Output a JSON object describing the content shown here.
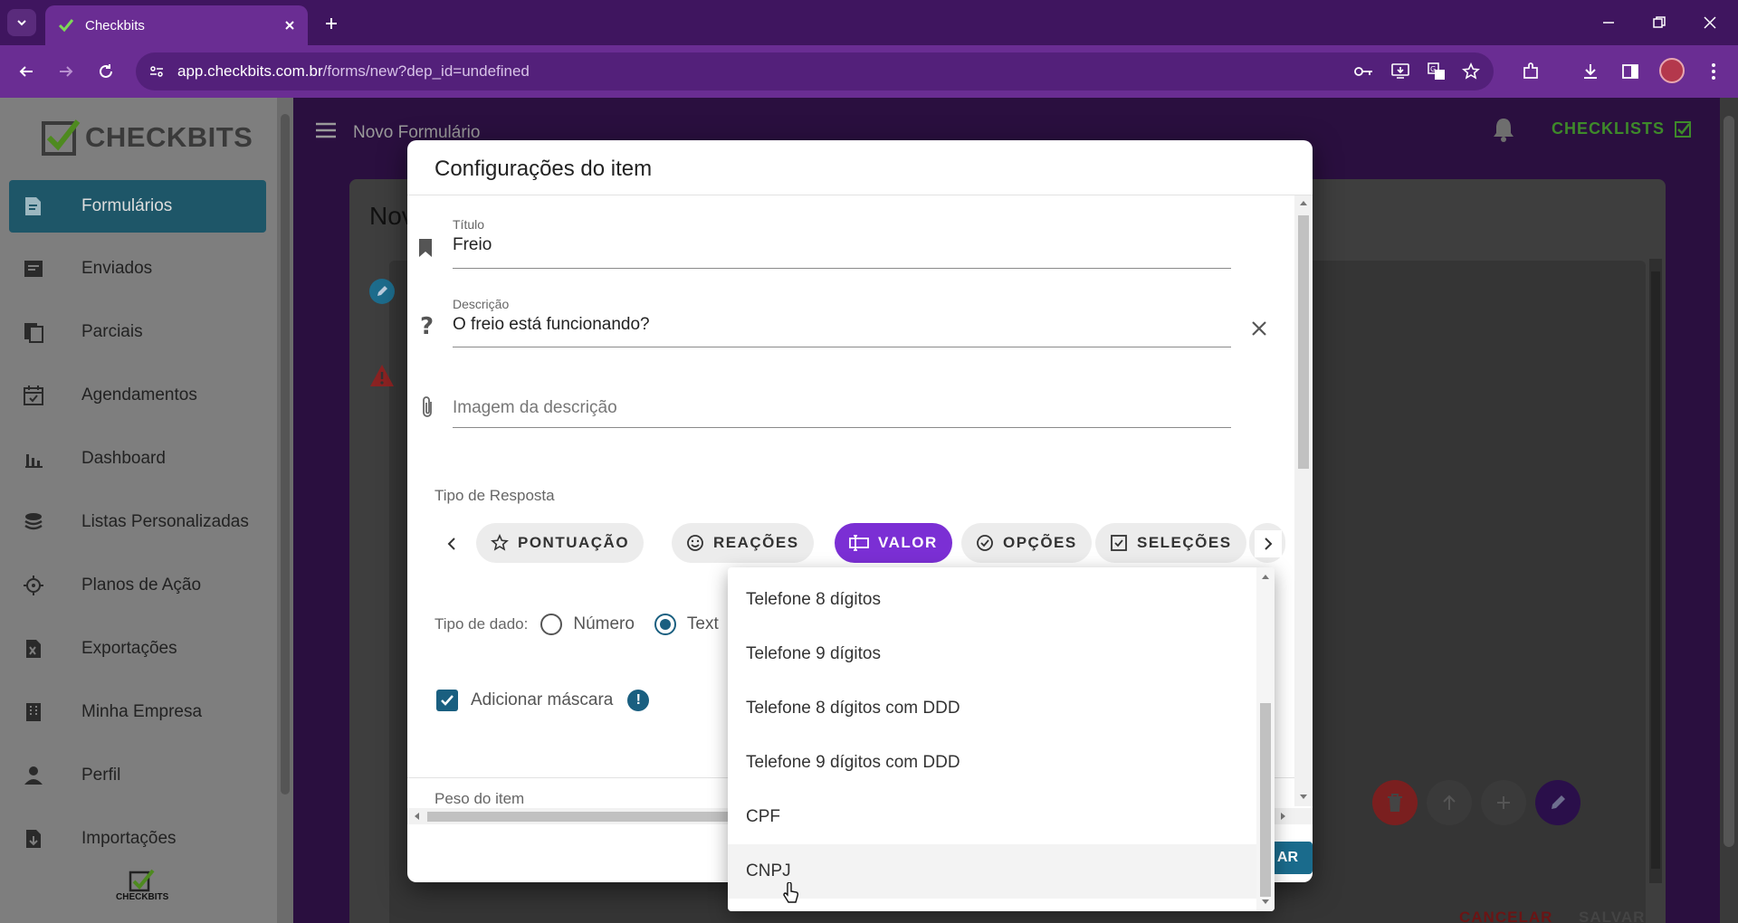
{
  "browser": {
    "tab_title": "Checkbits",
    "url_host": "app.checkbits.com.br",
    "url_path": "/forms/new?dep_id=undefined"
  },
  "sidebar": {
    "logo_text": "CHECKBITS",
    "small_logo_text": "CHECKBITS",
    "items": [
      {
        "label": "Formulários",
        "icon": "form-icon"
      },
      {
        "label": "Enviados",
        "icon": "sent-icon"
      },
      {
        "label": "Parciais",
        "icon": "partial-icon"
      },
      {
        "label": "Agendamentos",
        "icon": "calendar-icon"
      },
      {
        "label": "Dashboard",
        "icon": "bar-chart-icon"
      },
      {
        "label": "Listas Personalizadas",
        "icon": "stack-icon"
      },
      {
        "label": "Planos de Ação",
        "icon": "target-icon"
      },
      {
        "label": "Exportações",
        "icon": "export-icon"
      },
      {
        "label": "Minha Empresa",
        "icon": "building-icon"
      },
      {
        "label": "Perfil",
        "icon": "person-icon"
      },
      {
        "label": "Importações",
        "icon": "import-icon"
      }
    ]
  },
  "header": {
    "title": "Novo Formulário",
    "checklists_label": "CHECKLISTS"
  },
  "background": {
    "card_title": "Nov",
    "cancel_label": "CANCELAR",
    "save_label": "SALVAR"
  },
  "modal": {
    "title": "Configurações do item",
    "title_field": {
      "label": "Título",
      "value": "Freio"
    },
    "description_field": {
      "label": "Descrição",
      "value": "O freio está funcionando?"
    },
    "image_field": {
      "placeholder": "Imagem da descrição"
    },
    "response_type_label": "Tipo de Resposta",
    "chips": [
      {
        "label": "PONTUAÇÃO",
        "icon": "star-icon"
      },
      {
        "label": "REAÇÕES",
        "icon": "smiley-icon"
      },
      {
        "label": "VALOR",
        "icon": "input-icon",
        "active": true
      },
      {
        "label": "OPÇÕES",
        "icon": "check-circle-icon"
      },
      {
        "label": "SELEÇÕES",
        "icon": "check-box-icon"
      }
    ],
    "data_type_label": "Tipo de dado:",
    "data_type_options": [
      "Número",
      "Text"
    ],
    "data_type_selected": "Text",
    "mask_label": "Adicionar máscara",
    "mask_checked": true,
    "weight_label": "Peso do item",
    "save_partial": "AR"
  },
  "dropdown": {
    "options": [
      "Telefone 8 dígitos",
      "Telefone 9 dígitos",
      "Telefone 8 dígitos com DDD",
      "Telefone 9 dígitos com DDD",
      "CPF",
      "CNPJ"
    ],
    "hovered": "CNPJ"
  },
  "colors": {
    "accent_purple": "#7b2fd4",
    "brand_teal": "#1a5f80",
    "browser_purple": "#6a2d93",
    "checklists_green": "#3e8a2a"
  }
}
